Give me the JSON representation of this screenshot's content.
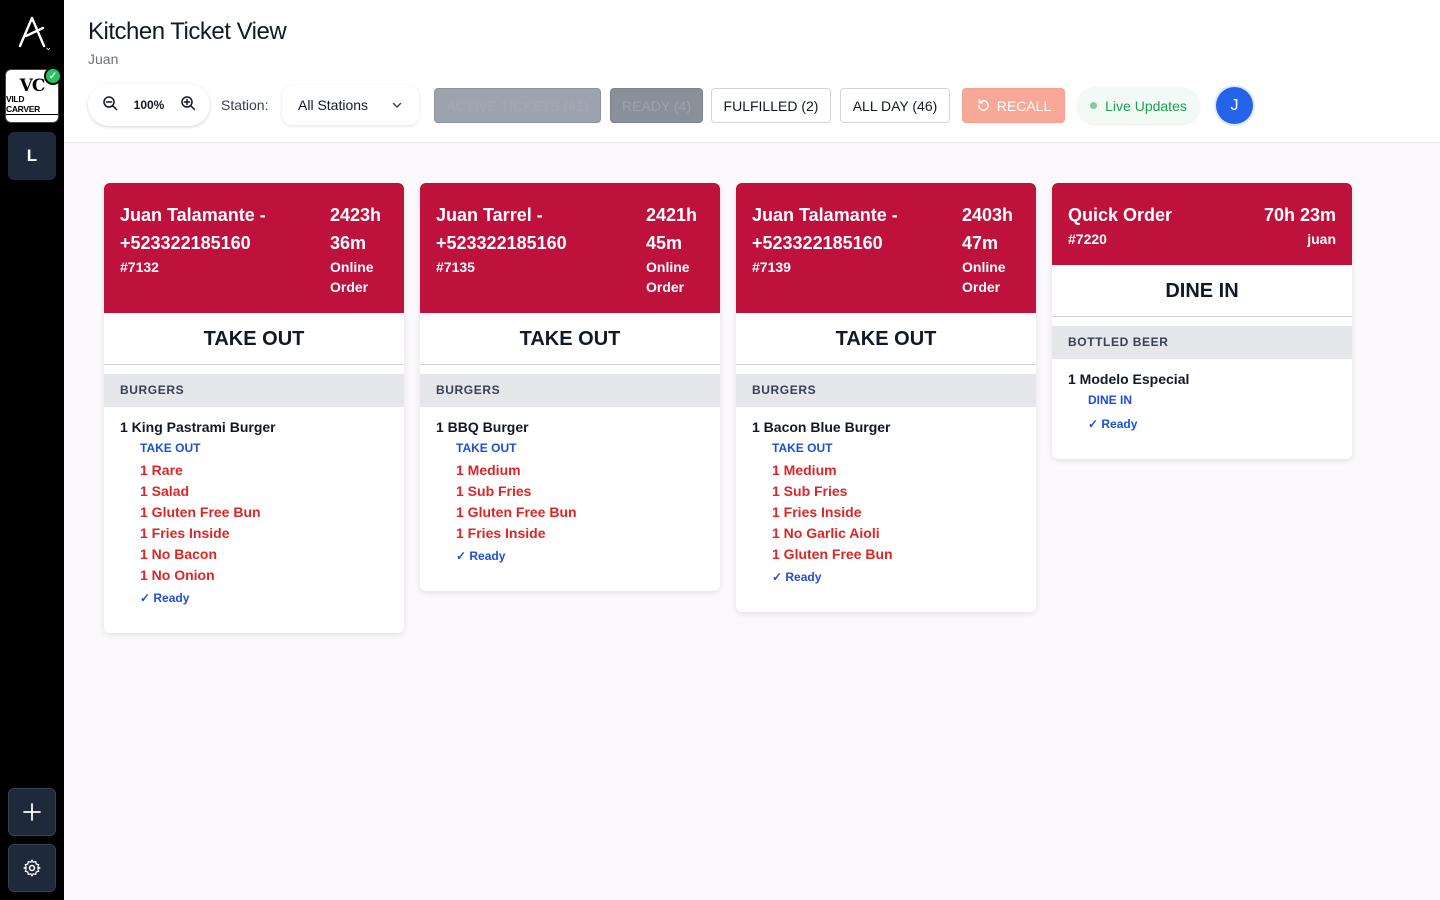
{
  "sidebar": {
    "brand": {
      "mark": "VC",
      "name": "VILD CARVER"
    },
    "location_initial": "L"
  },
  "header": {
    "title": "Kitchen Ticket View",
    "subtitle": "Juan",
    "zoom": "100%",
    "station_label": "Station:",
    "station_value": "All Stations",
    "buttons": {
      "active": "ACTIVE TICKETS (41)",
      "ready": "READY (4)",
      "fulfilled": "FULFILLED (2)",
      "all_day": "ALL DAY (46)",
      "recall": "RECALL"
    },
    "live": "Live Updates",
    "avatar": "J"
  },
  "colors": {
    "ticket_header": "#be123c",
    "modifier": "#dc2626",
    "mode": "#1d4ed8",
    "avatar": "#2563eb",
    "live": "#16a34a"
  },
  "tickets": [
    {
      "name": "Juan Talamante - +523322185160",
      "number": "#7132",
      "time": "2423h 36m",
      "source": "Online Order",
      "type": "TAKE OUT",
      "category": "BURGERS",
      "item": "1 King Pastrami Burger",
      "mode": "TAKE OUT",
      "modifiers": [
        "1 Rare",
        "1 Salad",
        "1 Gluten Free Bun",
        "1 Fries Inside",
        "1 No Bacon",
        "1 No Onion"
      ],
      "status": "✓ Ready"
    },
    {
      "name": "Juan Tarrel - +523322185160",
      "number": "#7135",
      "time": "2421h 45m",
      "source": "Online Order",
      "type": "TAKE OUT",
      "category": "BURGERS",
      "item": "1 BBQ Burger",
      "mode": "TAKE OUT",
      "modifiers": [
        "1 Medium",
        "1 Sub Fries",
        "1 Gluten Free Bun",
        "1 Fries Inside"
      ],
      "status": "✓ Ready"
    },
    {
      "name": "Juan Talamante - +523322185160",
      "number": "#7139",
      "time": "2403h 47m",
      "source": "Online Order",
      "type": "TAKE OUT",
      "category": "BURGERS",
      "item": "1 Bacon Blue Burger",
      "mode": "TAKE OUT",
      "modifiers": [
        "1 Medium",
        "1 Sub Fries",
        "1 Fries Inside",
        "1 No Garlic Aioli",
        "1 Gluten Free Bun"
      ],
      "status": "✓ Ready"
    },
    {
      "name": "Quick Order",
      "number": "#7220",
      "time": "70h 23m",
      "source": "juan",
      "type": "DINE IN",
      "category": "BOTTLED BEER",
      "item": "1 Modelo Especial",
      "mode": "DINE IN",
      "modifiers": [],
      "status": "✓ Ready"
    }
  ]
}
